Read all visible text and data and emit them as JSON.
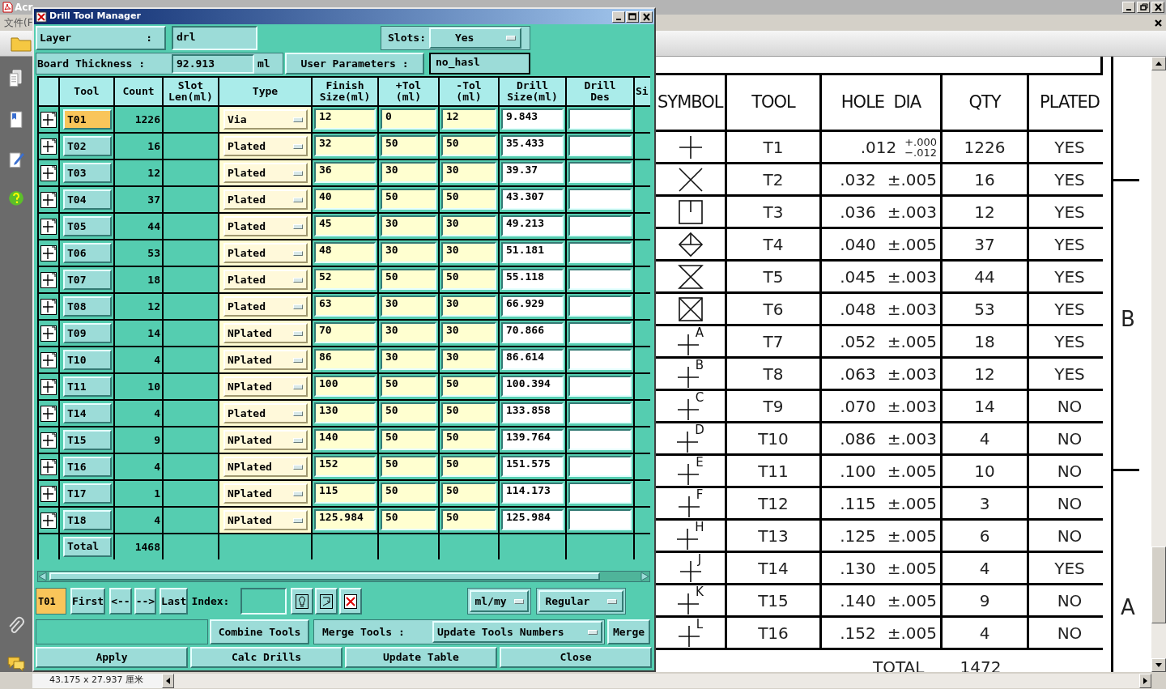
{
  "background_app": {
    "title": "Acr",
    "menu": [
      "文件(F"
    ],
    "status": "43.175 x 27.937 厘米"
  },
  "drawing": {
    "columns": [
      "SYMBOL",
      "TOOL",
      "HOLE  DIA",
      "QTY",
      "PLATED"
    ],
    "rows": [
      {
        "kind": "cross",
        "tool": "T1",
        "dia": ".012",
        "tol_upper": "+.000",
        "tol_lower": "−.012",
        "qty": "1226",
        "plated": "YES"
      },
      {
        "kind": "x",
        "tool": "T2",
        "dia": ".032",
        "tol": "±.005",
        "qty": "16",
        "plated": "YES"
      },
      {
        "kind": "square",
        "tool": "T3",
        "dia": ".036",
        "tol": "±.003",
        "qty": "12",
        "plated": "YES"
      },
      {
        "kind": "diamond",
        "tool": "T4",
        "dia": ".040",
        "tol": "±.005",
        "qty": "37",
        "plated": "YES"
      },
      {
        "kind": "hourglass",
        "tool": "T5",
        "dia": ".045",
        "tol": "±.003",
        "qty": "44",
        "plated": "YES"
      },
      {
        "kind": "boxed",
        "tool": "T6",
        "dia": ".048",
        "tol": "±.003",
        "qty": "53",
        "plated": "YES"
      },
      {
        "kind": "lettered",
        "letter": "A",
        "tool": "T7",
        "dia": ".052",
        "tol": "±.005",
        "qty": "18",
        "plated": "YES"
      },
      {
        "kind": "lettered",
        "letter": "B",
        "tool": "T8",
        "dia": ".063",
        "tol": "±.003",
        "qty": "12",
        "plated": "YES"
      },
      {
        "kind": "lettered",
        "letter": "C",
        "tool": "T9",
        "dia": ".070",
        "tol": "±.003",
        "qty": "14",
        "plated": "NO"
      },
      {
        "kind": "lettered",
        "letter": "D",
        "tool": "T10",
        "dia": ".086",
        "tol": "±.003",
        "qty": "4",
        "plated": "NO"
      },
      {
        "kind": "lettered",
        "letter": "E",
        "tool": "T11",
        "dia": ".100",
        "tol": "±.005",
        "qty": "10",
        "plated": "NO"
      },
      {
        "kind": "lettered",
        "letter": "F",
        "tool": "T12",
        "dia": ".115",
        "tol": "±.005",
        "qty": "3",
        "plated": "NO"
      },
      {
        "kind": "lettered",
        "letter": "H",
        "tool": "T13",
        "dia": ".125",
        "tol": "±.005",
        "qty": "6",
        "plated": "NO"
      },
      {
        "kind": "lettered",
        "letter": "J",
        "tool": "T14",
        "dia": ".130",
        "tol": "±.005",
        "qty": "4",
        "plated": "YES"
      },
      {
        "kind": "lettered",
        "letter": "K",
        "tool": "T15",
        "dia": ".140",
        "tol": "±.005",
        "qty": "9",
        "plated": "NO"
      },
      {
        "kind": "lettered",
        "letter": "L",
        "tool": "T16",
        "dia": ".152",
        "tol": "±.005",
        "qty": "4",
        "plated": "NO"
      }
    ],
    "total_label": "TOTAL",
    "total": "1472",
    "zones": [
      "B",
      "A"
    ]
  },
  "dialog": {
    "title": "Drill Tool Manager",
    "layer_label": "Layer",
    "layer_colon": ":",
    "layer": "drl",
    "slots_label": "Slots:",
    "slots": "Yes",
    "thickness_label": "Board Thickness :",
    "thickness": "92.913",
    "thickness_unit": "ml",
    "user_params_button": "User Parameters :",
    "user_params": "no_hasl",
    "columns": [
      "Tool",
      "Count",
      "Slot\nLen(ml)",
      "Type",
      "Finish\nSize(ml)",
      "+Tol\n(ml)",
      "-Tol\n(ml)",
      "Drill\nSize(ml)",
      "Drill\nDes",
      "Si"
    ],
    "rows": [
      {
        "tool": "T01",
        "count": "1226",
        "type": "Via",
        "finish": "12",
        "plus_tol": "0",
        "minus_tol": "12",
        "drill_size": "9.843",
        "selected": true
      },
      {
        "tool": "T02",
        "count": "16",
        "type": "Plated",
        "finish": "32",
        "plus_tol": "50",
        "minus_tol": "50",
        "drill_size": "35.433",
        "selected": false
      },
      {
        "tool": "T03",
        "count": "12",
        "type": "Plated",
        "finish": "36",
        "plus_tol": "30",
        "minus_tol": "30",
        "drill_size": "39.37",
        "selected": false
      },
      {
        "tool": "T04",
        "count": "37",
        "type": "Plated",
        "finish": "40",
        "plus_tol": "50",
        "minus_tol": "50",
        "drill_size": "43.307",
        "selected": false
      },
      {
        "tool": "T05",
        "count": "44",
        "type": "Plated",
        "finish": "45",
        "plus_tol": "30",
        "minus_tol": "30",
        "drill_size": "49.213",
        "selected": false
      },
      {
        "tool": "T06",
        "count": "53",
        "type": "Plated",
        "finish": "48",
        "plus_tol": "30",
        "minus_tol": "30",
        "drill_size": "51.181",
        "selected": false
      },
      {
        "tool": "T07",
        "count": "18",
        "type": "Plated",
        "finish": "52",
        "plus_tol": "50",
        "minus_tol": "50",
        "drill_size": "55.118",
        "selected": false
      },
      {
        "tool": "T08",
        "count": "12",
        "type": "Plated",
        "finish": "63",
        "plus_tol": "30",
        "minus_tol": "30",
        "drill_size": "66.929",
        "selected": false
      },
      {
        "tool": "T09",
        "count": "14",
        "type": "NPlated",
        "finish": "70",
        "plus_tol": "30",
        "minus_tol": "30",
        "drill_size": "70.866",
        "selected": false
      },
      {
        "tool": "T10",
        "count": "4",
        "type": "NPlated",
        "finish": "86",
        "plus_tol": "30",
        "minus_tol": "30",
        "drill_size": "86.614",
        "selected": false
      },
      {
        "tool": "T11",
        "count": "10",
        "type": "NPlated",
        "finish": "100",
        "plus_tol": "50",
        "minus_tol": "50",
        "drill_size": "100.394",
        "selected": false
      },
      {
        "tool": "T14",
        "count": "4",
        "type": "Plated",
        "finish": "130",
        "plus_tol": "50",
        "minus_tol": "50",
        "drill_size": "133.858",
        "selected": false
      },
      {
        "tool": "T15",
        "count": "9",
        "type": "NPlated",
        "finish": "140",
        "plus_tol": "50",
        "minus_tol": "50",
        "drill_size": "139.764",
        "selected": false
      },
      {
        "tool": "T16",
        "count": "4",
        "type": "NPlated",
        "finish": "152",
        "plus_tol": "50",
        "minus_tol": "50",
        "drill_size": "151.575",
        "selected": false
      },
      {
        "tool": "T17",
        "count": "1",
        "type": "NPlated",
        "finish": "115",
        "plus_tol": "50",
        "minus_tol": "50",
        "drill_size": "114.173",
        "selected": false
      },
      {
        "tool": "T18",
        "count": "4",
        "type": "NPlated",
        "finish": "125.984",
        "plus_tol": "50",
        "minus_tol": "50",
        "drill_size": "125.984",
        "selected": false
      }
    ],
    "total_label": "Total",
    "total": "1468",
    "current_tool": "T01",
    "nav_buttons": [
      "First",
      "<--",
      "-->",
      "Last"
    ],
    "index_label": "Index:",
    "units": "ml/my",
    "mode": "Regular",
    "combine_button": "Combine Tools",
    "merge_label": "Merge Tools :",
    "merge_option": "Update Tools Numbers",
    "merge_button": "Merge",
    "actions": [
      "Apply",
      "Calc Drills",
      "Update Table",
      "Close"
    ]
  }
}
